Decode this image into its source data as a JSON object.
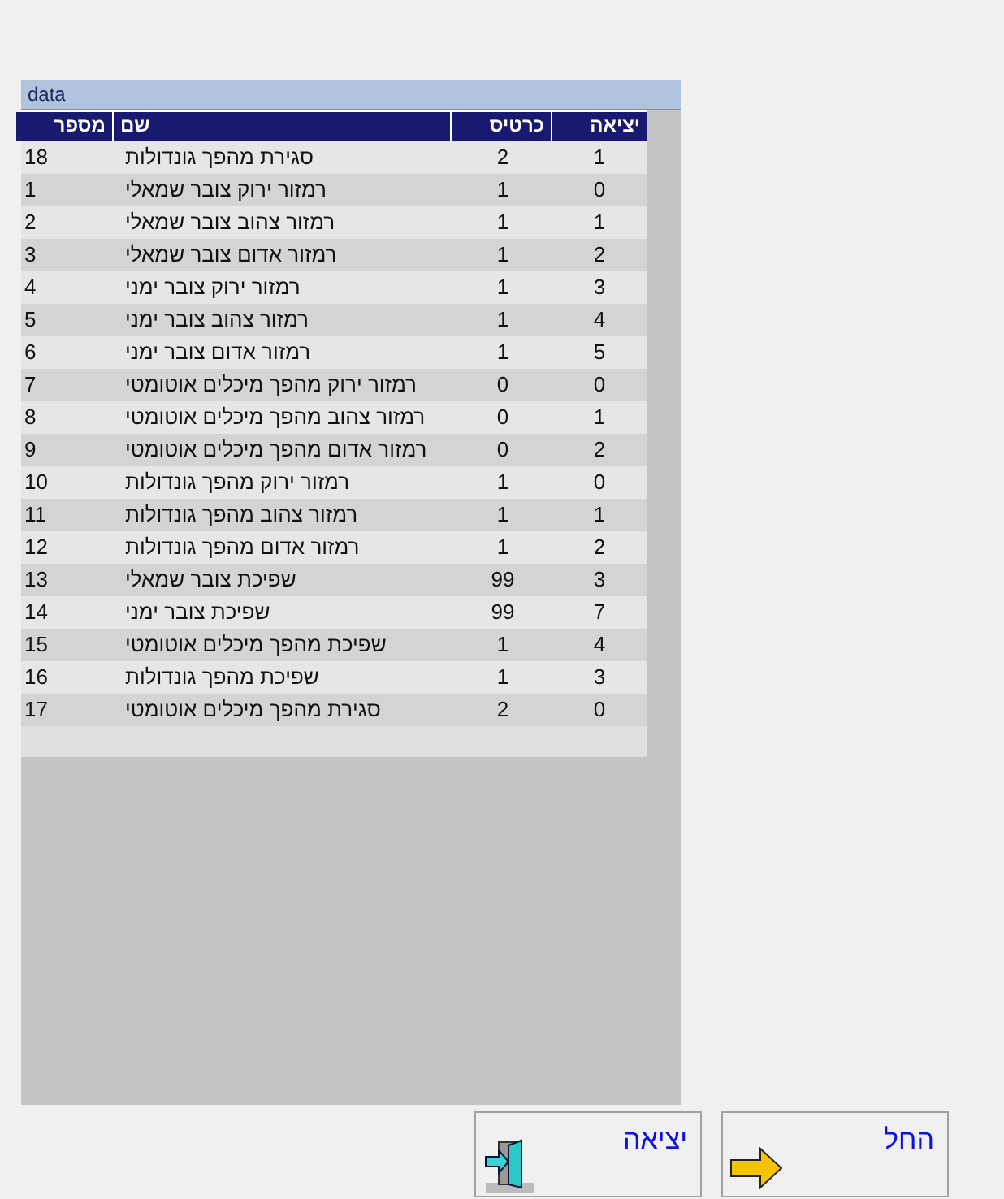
{
  "panel": {
    "title": "data"
  },
  "table": {
    "columns": [
      "יציאה",
      "כרטיס",
      "שם",
      "מספר"
    ],
    "rows": [
      [
        "1",
        "2",
        "סגירת מהפך גונדולות",
        "18"
      ],
      [
        "0",
        "1",
        "רמזור ירוק צובר שמאלי",
        "1"
      ],
      [
        "1",
        "1",
        "רמזור צהוב צובר שמאלי",
        "2"
      ],
      [
        "2",
        "1",
        "רמזור אדום צובר שמאלי",
        "3"
      ],
      [
        "3",
        "1",
        "רמזור ירוק צובר ימני",
        "4"
      ],
      [
        "4",
        "1",
        "רמזור צהוב צובר ימני",
        "5"
      ],
      [
        "5",
        "1",
        "רמזור אדום צובר ימני",
        "6"
      ],
      [
        "0",
        "0",
        "רמזור ירוק מהפך מיכלים אוטומטי",
        "7"
      ],
      [
        "1",
        "0",
        "רמזור צהוב מהפך מיכלים אוטומטי",
        "8"
      ],
      [
        "2",
        "0",
        "רמזור אדום מהפך מיכלים אוטומטי",
        "9"
      ],
      [
        "0",
        "1",
        "רמזור ירוק מהפך גונדולות",
        "10"
      ],
      [
        "1",
        "1",
        "רמזור צהוב מהפך גונדולות",
        "11"
      ],
      [
        "2",
        "1",
        "רמזור אדום מהפך גונדולות",
        "12"
      ],
      [
        "3",
        "99",
        "שפיכת צובר שמאלי",
        "13"
      ],
      [
        "7",
        "99",
        "שפיכת צובר ימני",
        "14"
      ],
      [
        "4",
        "1",
        "שפיכת מהפך מיכלים אוטומטי",
        "15"
      ],
      [
        "3",
        "1",
        "שפיכת מהפך גונדולות",
        "16"
      ],
      [
        "0",
        "2",
        "סגירת מהפך מיכלים אוטומטי",
        "17"
      ]
    ]
  },
  "buttons": [
    {
      "label": "החל",
      "kind": "apply"
    },
    {
      "label": "יציאה",
      "kind": "exit"
    }
  ]
}
